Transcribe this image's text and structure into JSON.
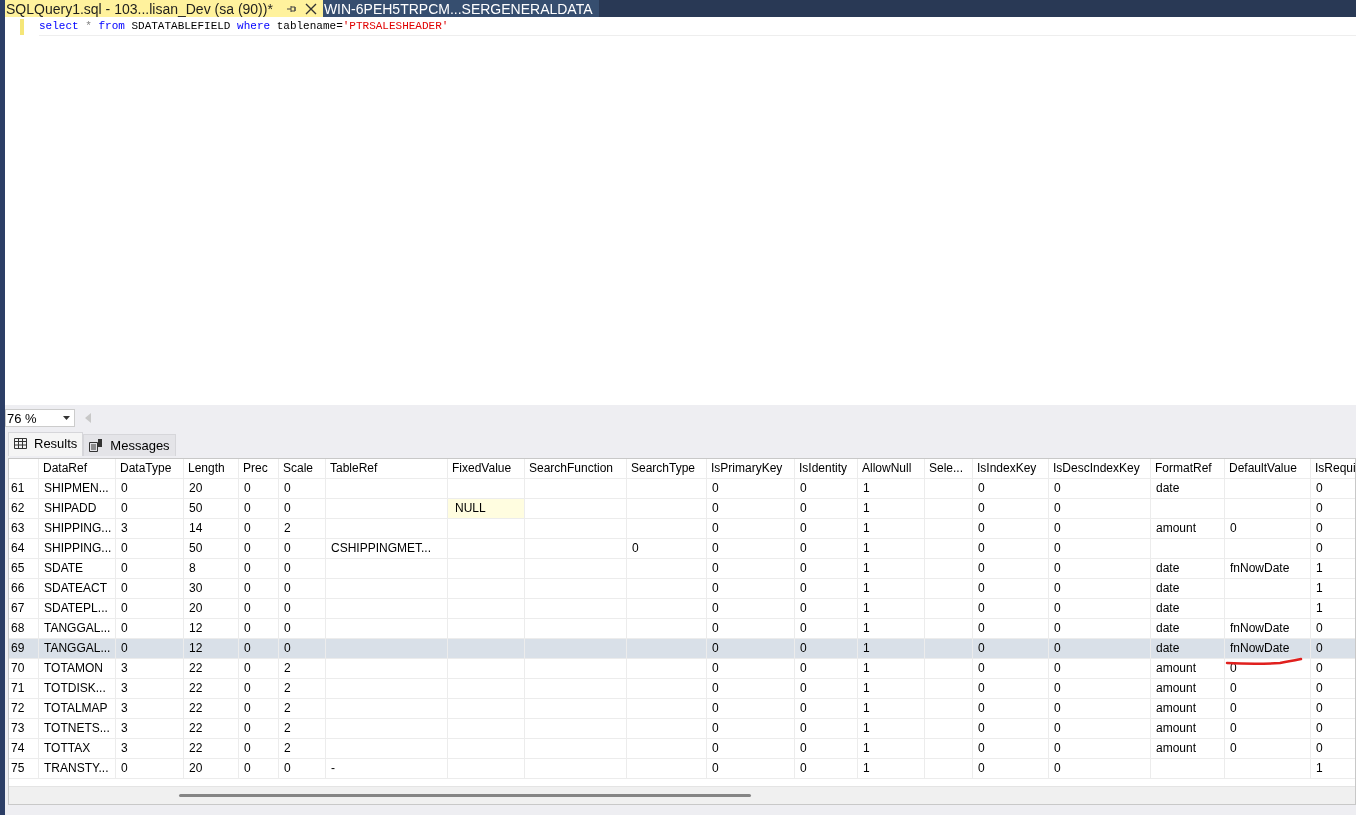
{
  "document_tabs": [
    {
      "label": "SQLQuery1.sql - 103...lisan_Dev (sa (90))*",
      "selected": true
    },
    {
      "label": "WIN-6PEH5TRPCM...SERGENERALDATA",
      "selected": false
    }
  ],
  "editor": {
    "query": [
      {
        "kind": "keyword",
        "text": "select"
      },
      {
        "kind": "operator",
        "text": "*"
      },
      {
        "kind": "keyword",
        "text": "from"
      },
      {
        "kind": "plain",
        "text": "SDATATABLEFIELD"
      },
      {
        "kind": "keyword",
        "text": "where"
      },
      {
        "kind": "plain",
        "text": "tablename="
      },
      {
        "kind": "string",
        "text": "'PTRSALESHEADER'",
        "joined": true
      }
    ]
  },
  "zoom": {
    "value": "76 %"
  },
  "result_tabs": [
    {
      "label": "Results",
      "selected": true
    },
    {
      "label": "Messages",
      "selected": false
    }
  ],
  "table": {
    "columns": [
      "DataRef",
      "DataType",
      "Length",
      "Prec",
      "Scale",
      "TableRef",
      "FixedValue",
      "SearchFunction",
      "SearchType",
      "IsPrimaryKey",
      "IsIdentity",
      "AllowNull",
      "Sele...",
      "IsIndexKey",
      "IsDescIndexKey",
      "FormatRef",
      "DefaultValue",
      "IsRequi"
    ],
    "rows": [
      {
        "number": "61",
        "selected": false,
        "cells": [
          "SHIPMEN...",
          "0",
          "20",
          "0",
          "0",
          "",
          "",
          "",
          "",
          "0",
          "0",
          "1",
          "",
          "0",
          "0",
          "date",
          "",
          "0"
        ]
      },
      {
        "number": "62",
        "selected": false,
        "cells": [
          "SHIPADD",
          "0",
          "50",
          "0",
          "0",
          "",
          {
            "kind": "null",
            "text": "NULL"
          },
          "",
          "",
          "0",
          "0",
          "1",
          "",
          "0",
          "0",
          "",
          "",
          "0"
        ]
      },
      {
        "number": "63",
        "selected": false,
        "cells": [
          "SHIPPING...",
          "3",
          "14",
          "0",
          "2",
          "",
          "",
          "",
          "",
          "0",
          "0",
          "1",
          "",
          "0",
          "0",
          "amount",
          "0",
          "0"
        ]
      },
      {
        "number": "64",
        "selected": false,
        "cells": [
          "SHIPPING...",
          "0",
          "50",
          "0",
          "0",
          "CSHIPPINGMET...",
          "",
          "",
          "0",
          "0",
          "0",
          "1",
          "",
          "0",
          "0",
          "",
          "",
          "0"
        ]
      },
      {
        "number": "65",
        "selected": false,
        "cells": [
          "SDATE",
          "0",
          "8",
          "0",
          "0",
          "",
          "",
          "",
          "",
          "0",
          "0",
          "1",
          "",
          "0",
          "0",
          "date",
          "fnNowDate",
          "1"
        ]
      },
      {
        "number": "66",
        "selected": false,
        "cells": [
          "SDATEACT",
          "0",
          "30",
          "0",
          "0",
          "",
          "",
          "",
          "",
          "0",
          "0",
          "1",
          "",
          "0",
          "0",
          "date",
          "",
          "1"
        ]
      },
      {
        "number": "67",
        "selected": false,
        "cells": [
          "SDATEPL...",
          "0",
          "20",
          "0",
          "0",
          "",
          "",
          "",
          "",
          "0",
          "0",
          "1",
          "",
          "0",
          "0",
          "date",
          "",
          "1"
        ]
      },
      {
        "number": "68",
        "selected": false,
        "cells": [
          "TANGGAL...",
          "0",
          "12",
          "0",
          "0",
          "",
          "",
          "",
          "",
          "0",
          "0",
          "1",
          "",
          "0",
          "0",
          "date",
          "fnNowDate",
          "0"
        ]
      },
      {
        "number": "69",
        "selected": true,
        "cells": [
          "TANGGAL...",
          "0",
          "12",
          "0",
          "0",
          "",
          "",
          "",
          "",
          "0",
          "0",
          "1",
          "",
          "0",
          "0",
          "date",
          "fnNowDate",
          "0"
        ]
      },
      {
        "number": "70",
        "selected": false,
        "cells": [
          "TOTAMON",
          "3",
          "22",
          "0",
          "2",
          "",
          "",
          "",
          "",
          "0",
          "0",
          "1",
          "",
          "0",
          "0",
          "amount",
          "0",
          "0"
        ]
      },
      {
        "number": "71",
        "selected": false,
        "cells": [
          "TOTDISK...",
          "3",
          "22",
          "0",
          "2",
          "",
          "",
          "",
          "",
          "0",
          "0",
          "1",
          "",
          "0",
          "0",
          "amount",
          "0",
          "0"
        ]
      },
      {
        "number": "72",
        "selected": false,
        "cells": [
          "TOTALMAP",
          "3",
          "22",
          "0",
          "2",
          "",
          "",
          "",
          "",
          "0",
          "0",
          "1",
          "",
          "0",
          "0",
          "amount",
          "0",
          "0"
        ]
      },
      {
        "number": "73",
        "selected": false,
        "cells": [
          "TOTNETS...",
          "3",
          "22",
          "0",
          "2",
          "",
          "",
          "",
          "",
          "0",
          "0",
          "1",
          "",
          "0",
          "0",
          "amount",
          "0",
          "0"
        ]
      },
      {
        "number": "74",
        "selected": false,
        "cells": [
          "TOTTAX",
          "3",
          "22",
          "0",
          "2",
          "",
          "",
          "",
          "",
          "0",
          "0",
          "1",
          "",
          "0",
          "0",
          "amount",
          "0",
          "0"
        ]
      },
      {
        "number": "75",
        "selected": false,
        "cells": [
          "TRANSTY...",
          "0",
          "20",
          "0",
          "0",
          "-",
          "",
          "",
          "",
          "0",
          "0",
          "1",
          "",
          "0",
          "0",
          "",
          "",
          "1"
        ]
      }
    ]
  }
}
